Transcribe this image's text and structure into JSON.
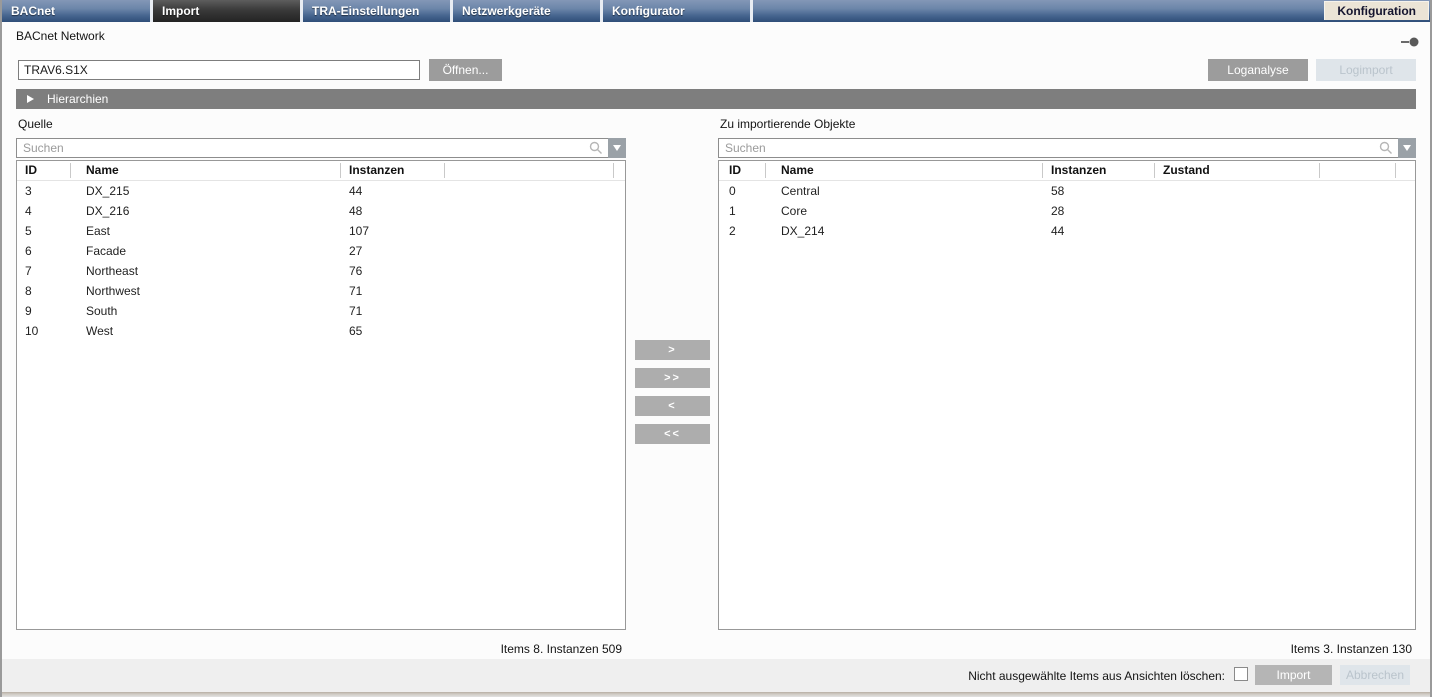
{
  "tabs": {
    "items": [
      {
        "label": "BACnet"
      },
      {
        "label": "Import"
      },
      {
        "label": "TRA-Einstellungen"
      },
      {
        "label": "Netzwerkgeräte"
      },
      {
        "label": "Konfigurator"
      }
    ],
    "active": "Import",
    "right_tab": "Konfiguration"
  },
  "header": {
    "title": "BACnet Network"
  },
  "toolbar": {
    "file_value": "TRAV6.S1X",
    "open_button": "Öffnen...",
    "loganalyse_button": "Loganalyse",
    "logimport_button": "Logimport"
  },
  "hierarchy_bar": {
    "label": "Hierarchien"
  },
  "source_panel": {
    "title": "Quelle",
    "search_placeholder": "Suchen",
    "columns": {
      "id": "ID",
      "name": "Name",
      "instanzen": "Instanzen"
    },
    "rows": [
      {
        "id": "3",
        "name": "DX_215",
        "instanzen": "44"
      },
      {
        "id": "4",
        "name": "DX_216",
        "instanzen": "48"
      },
      {
        "id": "5",
        "name": "East",
        "instanzen": "107"
      },
      {
        "id": "6",
        "name": "Facade",
        "instanzen": "27"
      },
      {
        "id": "7",
        "name": "Northeast",
        "instanzen": "76"
      },
      {
        "id": "8",
        "name": "Northwest",
        "instanzen": "71"
      },
      {
        "id": "9",
        "name": "South",
        "instanzen": "71"
      },
      {
        "id": "10",
        "name": "West",
        "instanzen": "65"
      }
    ],
    "footer": "Items 8. Instanzen 509"
  },
  "target_panel": {
    "title": "Zu importierende Objekte",
    "search_placeholder": "Suchen",
    "columns": {
      "id": "ID",
      "name": "Name",
      "instanzen": "Instanzen",
      "zustand": "Zustand"
    },
    "rows": [
      {
        "id": "0",
        "name": "Central",
        "instanzen": "58",
        "zustand": ""
      },
      {
        "id": "1",
        "name": "Core",
        "instanzen": "28",
        "zustand": ""
      },
      {
        "id": "2",
        "name": "DX_214",
        "instanzen": "44",
        "zustand": ""
      }
    ],
    "footer": "Items 3. Instanzen 130"
  },
  "transfer_buttons": {
    "add": ">",
    "add_all": ">>",
    "remove": "<",
    "remove_all": "<<"
  },
  "action_bar": {
    "checkbox_label": "Nicht ausgewählte Items aus Ansichten löschen:",
    "import_button": "Import",
    "cancel_button": "Abbrechen"
  },
  "colors": {
    "tab_bar_top": "#8397b7",
    "tab_bar_bottom": "#2f4e78",
    "active_tab": "#232323",
    "accent_tab_bg": "#ebe4d6",
    "button_gray": "#9c9c9c",
    "disabled_button_bg": "#dfe5ea",
    "disabled_button_text": "#bac4cc",
    "bar_gray": "#7e7e7e"
  }
}
